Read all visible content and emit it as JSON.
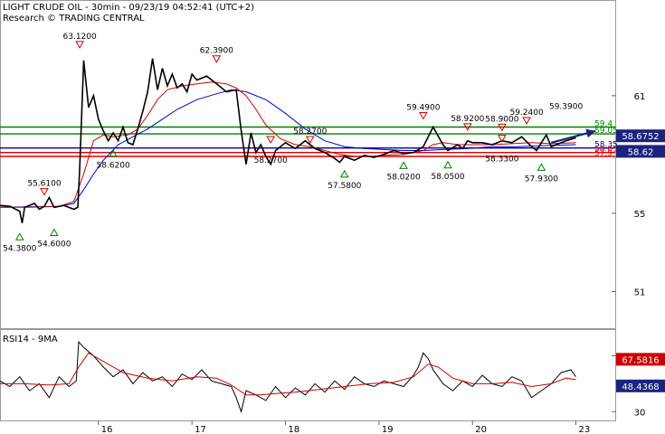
{
  "header": {
    "line1": "LIGHT CRUDE OIL - 30min - 09/23/19 04:52:41 (UTC+2)",
    "line2": "Research © TRADING CENTRAL"
  },
  "rsi_panel": {
    "title": "RSI14 - 9MA"
  },
  "colors": {
    "price": "#000000",
    "ma_fast": "#cc0000",
    "ma_slow": "#0000cc",
    "resistance": "#008000",
    "pivot": "#0000aa",
    "support": "#dd0000",
    "arrow": "#1a237e"
  },
  "chart_data": {
    "type": "line",
    "x_ticks": [
      {
        "label": "16",
        "x": 0.2
      },
      {
        "label": "17",
        "x": 0.39
      },
      {
        "label": "18",
        "x": 0.58
      },
      {
        "label": "19",
        "x": 0.77
      },
      {
        "label": "20",
        "x": 0.96
      },
      {
        "label": "23",
        "x": 1.17
      }
    ],
    "price_axis": {
      "ylim": [
        49.5,
        64.5
      ],
      "ticks": [
        51,
        55,
        61
      ]
    },
    "rsi_axis": {
      "ylim": [
        25,
        82
      ],
      "ticks": [
        30,
        70
      ]
    },
    "price_series": {
      "name": "Price",
      "x": [
        0.0,
        0.02,
        0.04,
        0.045,
        0.05,
        0.07,
        0.08,
        0.09,
        0.1,
        0.11,
        0.13,
        0.15,
        0.158,
        0.162,
        0.17,
        0.18,
        0.19,
        0.2,
        0.21,
        0.22,
        0.23,
        0.24,
        0.25,
        0.26,
        0.27,
        0.28,
        0.29,
        0.3,
        0.31,
        0.32,
        0.33,
        0.34,
        0.35,
        0.36,
        0.37,
        0.38,
        0.39,
        0.4,
        0.42,
        0.44,
        0.46,
        0.48,
        0.49,
        0.5,
        0.51,
        0.52,
        0.53,
        0.54,
        0.55,
        0.56,
        0.58,
        0.6,
        0.62,
        0.64,
        0.66,
        0.68,
        0.69,
        0.7,
        0.72,
        0.74,
        0.76,
        0.78,
        0.8,
        0.82,
        0.84,
        0.86,
        0.88,
        0.9,
        0.91,
        0.92,
        0.93,
        0.94,
        0.95,
        0.96,
        0.98,
        1.0,
        1.02,
        1.04,
        1.06,
        1.08,
        1.09,
        1.1,
        1.11,
        1.12,
        1.13,
        1.15,
        1.17
      ],
      "y": [
        55.4,
        55.35,
        55.1,
        54.5,
        55.3,
        55.5,
        55.2,
        55.35,
        55.8,
        55.3,
        55.4,
        55.2,
        55.3,
        57.3,
        62.8,
        60.4,
        61.0,
        59.8,
        59.2,
        58.7,
        59.1,
        58.7,
        59.4,
        58.6,
        58.5,
        59.3,
        60.2,
        61.2,
        62.9,
        61.3,
        62.4,
        61.5,
        62.1,
        61.4,
        61.6,
        61.2,
        62.1,
        61.8,
        62.0,
        61.6,
        61.2,
        61.3,
        59.2,
        57.5,
        59.1,
        58.1,
        58.5,
        57.9,
        57.5,
        58.2,
        58.6,
        58.3,
        58.7,
        58.3,
        58.1,
        57.8,
        57.6,
        57.9,
        57.7,
        57.95,
        57.85,
        58.0,
        58.2,
        58.05,
        58.1,
        58.4,
        59.4,
        58.5,
        58.2,
        58.35,
        58.5,
        58.3,
        58.7,
        58.6,
        58.6,
        58.5,
        58.7,
        58.6,
        58.9,
        58.4,
        58.2,
        58.6,
        59.0,
        58.4,
        58.5,
        58.7,
        58.85
      ]
    },
    "ma_fast_series": {
      "name": "MA fast",
      "x": [
        0.0,
        0.06,
        0.12,
        0.15,
        0.17,
        0.19,
        0.21,
        0.23,
        0.26,
        0.28,
        0.3,
        0.32,
        0.34,
        0.37,
        0.4,
        0.43,
        0.46,
        0.48,
        0.5,
        0.52,
        0.54,
        0.57,
        0.6,
        0.63,
        0.66,
        0.69,
        0.72,
        0.75,
        0.78,
        0.82,
        0.86,
        0.88,
        0.9,
        0.93,
        0.96,
        1.0,
        1.04,
        1.08,
        1.12,
        1.17
      ],
      "y": [
        55.3,
        55.3,
        55.35,
        55.6,
        57.0,
        58.7,
        59.0,
        58.9,
        59.0,
        59.3,
        60.0,
        60.8,
        61.3,
        61.5,
        61.6,
        61.7,
        61.6,
        61.4,
        61.0,
        60.3,
        59.5,
        58.8,
        58.5,
        58.4,
        58.2,
        58.0,
        57.9,
        57.9,
        57.95,
        58.0,
        58.2,
        58.5,
        58.6,
        58.5,
        58.5,
        58.5,
        58.55,
        58.6,
        58.55,
        58.6
      ]
    },
    "ma_slow_series": {
      "name": "MA slow",
      "x": [
        0.0,
        0.12,
        0.15,
        0.17,
        0.19,
        0.21,
        0.24,
        0.27,
        0.3,
        0.33,
        0.36,
        0.4,
        0.44,
        0.47,
        0.5,
        0.54,
        0.58,
        0.62,
        0.66,
        0.7,
        0.74,
        0.78,
        0.82,
        0.86,
        0.9,
        0.95,
        1.0,
        1.05,
        1.1,
        1.17
      ],
      "y": [
        55.3,
        55.35,
        55.5,
        56.2,
        57.0,
        57.7,
        58.5,
        58.9,
        59.3,
        59.8,
        60.3,
        60.8,
        61.1,
        61.3,
        61.2,
        60.8,
        60.1,
        59.3,
        58.7,
        58.4,
        58.3,
        58.25,
        58.2,
        58.2,
        58.25,
        58.3,
        58.4,
        58.4,
        58.45,
        58.5
      ]
    },
    "levels": [
      {
        "value": 59.4,
        "label": "59.4",
        "kind": "resistance"
      },
      {
        "value": 59.05,
        "label": "59.05",
        "kind": "resistance"
      },
      {
        "value": 58.33,
        "label": "58.35",
        "kind": "pivot"
      },
      {
        "value": 58.1,
        "label": "58.05",
        "kind": "support"
      },
      {
        "value": 57.9,
        "label": "57.9",
        "kind": "support"
      }
    ],
    "price_tags": [
      {
        "value": 58.6752,
        "label": "58.6752",
        "bg": "#1a237e"
      },
      {
        "value": 58.62,
        "label": "58.62",
        "bg": "#1a237e"
      }
    ],
    "markers": [
      {
        "x": 0.04,
        "y": 54.38,
        "type": "low",
        "label": "54.3800"
      },
      {
        "x": 0.09,
        "y": 55.61,
        "type": "high",
        "label": "55.6100"
      },
      {
        "x": 0.11,
        "y": 54.6,
        "type": "low",
        "label": "54.6000"
      },
      {
        "x": 0.162,
        "y": 63.12,
        "type": "high",
        "label": "63.1200"
      },
      {
        "x": 0.23,
        "y": 58.62,
        "type": "low",
        "label": "58.6200"
      },
      {
        "x": 0.44,
        "y": 62.39,
        "type": "high",
        "label": "62.3900"
      },
      {
        "x": 0.55,
        "y": 58.27,
        "type": "high2",
        "label": "58.2700"
      },
      {
        "x": 0.63,
        "y": 58.27,
        "type": "high",
        "label": "58.2700"
      },
      {
        "x": 0.7,
        "y": 57.58,
        "type": "low",
        "label": "57.5800"
      },
      {
        "x": 0.82,
        "y": 58.02,
        "type": "low",
        "label": "58.0200"
      },
      {
        "x": 0.86,
        "y": 59.49,
        "type": "high",
        "label": "59.4900"
      },
      {
        "x": 0.91,
        "y": 58.05,
        "type": "low",
        "label": "58.0500"
      },
      {
        "x": 0.95,
        "y": 58.92,
        "type": "high",
        "label": "58.9200"
      },
      {
        "x": 1.02,
        "y": 58.33,
        "type": "high2",
        "label": "58.3300"
      },
      {
        "x": 1.02,
        "y": 58.9,
        "type": "high",
        "label": "58.9000"
      },
      {
        "x": 1.07,
        "y": 59.24,
        "type": "high",
        "label": "59.2400"
      },
      {
        "x": 1.1,
        "y": 57.93,
        "type": "low",
        "label": "57.9300"
      },
      {
        "x": 1.15,
        "y": 59.39,
        "type": "label_only",
        "label": "59.3900"
      }
    ],
    "forecast_arrow": {
      "x1": 1.12,
      "y1": 58.6,
      "x2": 1.21,
      "y2": 59.2
    },
    "rsi_series": {
      "name": "RSI14",
      "x": [
        0.0,
        0.02,
        0.04,
        0.06,
        0.08,
        0.1,
        0.12,
        0.14,
        0.155,
        0.16,
        0.17,
        0.19,
        0.21,
        0.23,
        0.25,
        0.27,
        0.29,
        0.31,
        0.33,
        0.35,
        0.37,
        0.39,
        0.41,
        0.43,
        0.45,
        0.47,
        0.48,
        0.49,
        0.5,
        0.52,
        0.54,
        0.56,
        0.58,
        0.6,
        0.62,
        0.64,
        0.66,
        0.68,
        0.7,
        0.72,
        0.74,
        0.76,
        0.78,
        0.8,
        0.82,
        0.84,
        0.85,
        0.86,
        0.87,
        0.88,
        0.89,
        0.9,
        0.92,
        0.94,
        0.96,
        0.98,
        1.0,
        1.02,
        1.04,
        1.06,
        1.08,
        1.1,
        1.12,
        1.14,
        1.16,
        1.17
      ],
      "y": [
        52,
        48,
        55,
        45,
        50,
        40,
        55,
        48,
        52,
        80,
        76,
        70,
        62,
        55,
        60,
        50,
        58,
        52,
        55,
        48,
        57,
        53,
        60,
        52,
        50,
        48,
        40,
        30,
        45,
        42,
        38,
        48,
        40,
        47,
        42,
        50,
        44,
        52,
        46,
        55,
        50,
        48,
        52,
        50,
        48,
        56,
        62,
        72,
        68,
        60,
        55,
        50,
        45,
        52,
        48,
        56,
        50,
        48,
        55,
        52,
        40,
        45,
        50,
        58,
        60,
        55
      ]
    },
    "rsi_ma_series": {
      "name": "9MA",
      "x": [
        0.0,
        0.05,
        0.1,
        0.14,
        0.16,
        0.18,
        0.21,
        0.25,
        0.3,
        0.35,
        0.4,
        0.44,
        0.47,
        0.5,
        0.53,
        0.56,
        0.6,
        0.65,
        0.7,
        0.75,
        0.8,
        0.84,
        0.87,
        0.89,
        0.92,
        0.96,
        1.0,
        1.04,
        1.08,
        1.12,
        1.15,
        1.17
      ],
      "y": [
        50,
        50,
        49,
        50,
        62,
        72,
        66,
        58,
        54,
        52,
        55,
        54,
        49,
        42,
        42,
        43,
        44,
        46,
        48,
        50,
        51,
        55,
        64,
        62,
        54,
        50,
        50,
        51,
        48,
        50,
        54,
        53
      ]
    },
    "rsi_tags": [
      {
        "value": 67.5,
        "label": "67.5816",
        "bg": "#cc0000"
      },
      {
        "value": 48.4368,
        "label": "48.4368",
        "bg": "#1a237e"
      }
    ]
  }
}
